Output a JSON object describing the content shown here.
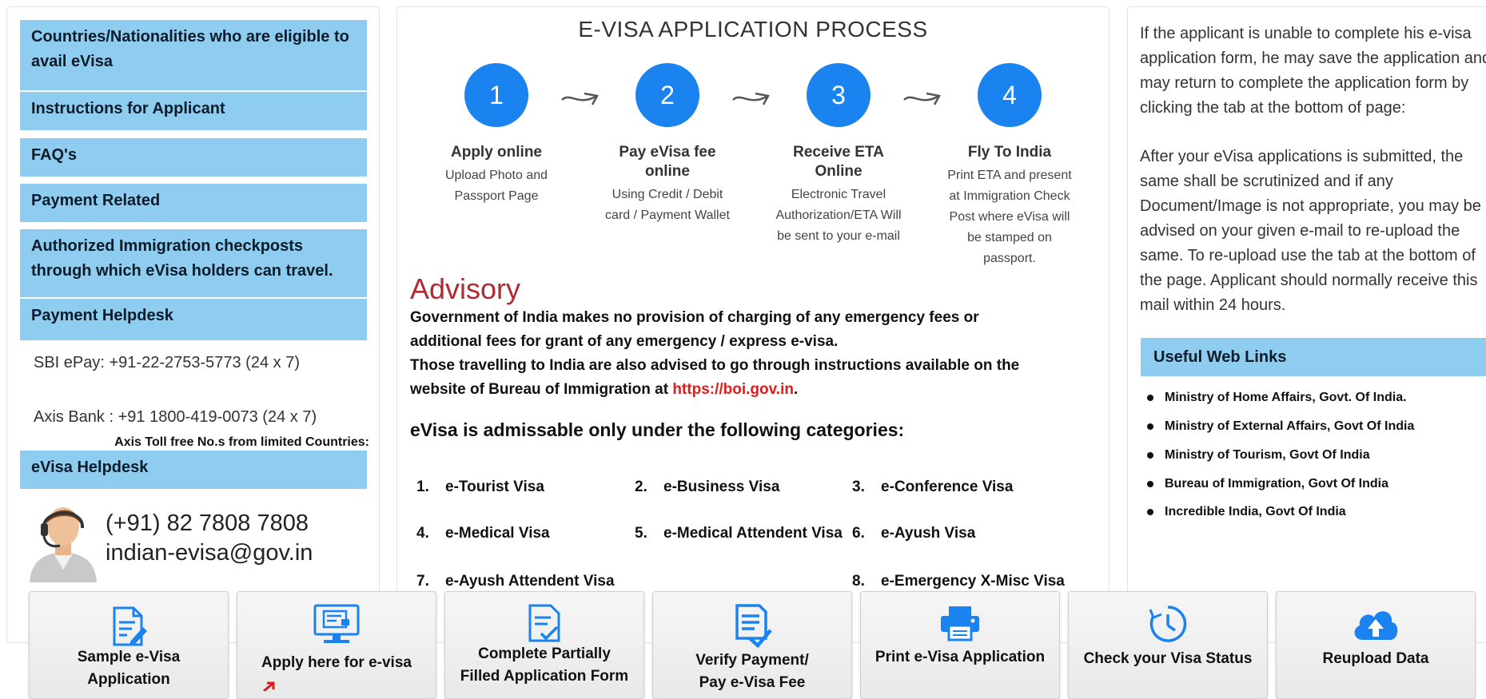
{
  "sidebar": {
    "items": [
      {
        "label": "Countries/Nationalities who are eligible to avail eVisa"
      },
      {
        "label": "Instructions for Applicant"
      },
      {
        "label": "FAQ's"
      },
      {
        "label": "Payment Related"
      },
      {
        "label": "Authorized Immigration checkposts through which eVisa holders can travel."
      },
      {
        "label": "Payment Helpdesk"
      }
    ],
    "payment_helpdesk": {
      "sbi": "SBI ePay: +91-22-2753-5773 (24 x 7)",
      "axis": "Axis Bank : +91 1800-419-0073 (24 x 7)",
      "toll_free_note": "Axis Toll free No.s from limited Countries:"
    },
    "evisa_helpdesk": {
      "label": "eVisa Helpdesk",
      "phone": "(+91) 82 7808 7808",
      "email": "indian-evisa@gov.in"
    }
  },
  "process": {
    "title": "E-VISA APPLICATION PROCESS",
    "steps": [
      {
        "number": "1",
        "title": "Apply online",
        "desc": "Upload Photo and Passport Page"
      },
      {
        "number": "2",
        "title": "Pay eVisa fee online",
        "desc": "Using Credit / Debit card / Payment Wallet"
      },
      {
        "number": "3",
        "title": "Receive ETA Online",
        "desc": "Electronic Travel Authorization/ETA Will be sent to your e-mail"
      },
      {
        "number": "4",
        "title": "Fly To India",
        "desc": "Print ETA and present at Immigration Check Post where eVisa will be stamped on passport."
      }
    ]
  },
  "advisory": {
    "heading": "Advisory",
    "line1": "Government of India makes no provision of charging of any emergency fees or",
    "line2": "additional fees for grant of any emergency / express e-visa.",
    "line3": "Those travelling to India are also advised to go through instructions available on the",
    "line4_prefix": "website of Bureau of Immigration at ",
    "link": "https://boi.gov.in",
    "line4_suffix": ".",
    "categories_heading": "eVisa is admissable only under the following categories:",
    "categories": [
      {
        "num": "1.",
        "label": "e-Tourist Visa"
      },
      {
        "num": "2.",
        "label": "e-Business Visa"
      },
      {
        "num": "3.",
        "label": "e-Conference Visa"
      },
      {
        "num": "4.",
        "label": "e-Medical Visa"
      },
      {
        "num": "5.",
        "label": "e-Medical Attendent Visa"
      },
      {
        "num": "6.",
        "label": "e-Ayush Visa"
      },
      {
        "num": "7.",
        "label": "e-Ayush Attendent Visa"
      },
      {
        "num": "8.",
        "label": "e-Emergency X-Misc Visa"
      }
    ]
  },
  "info": {
    "para1": "If the applicant is unable to complete his e-visa application form, he may save the application and may return to complete the application form by clicking the tab at the bottom of page:",
    "para2": "After your eVisa applications is submitted, the same shall be scrutinized and if any Document/Image is not appropriate, you may be advised on your given e-mail to re-upload the same. To re-upload use the tab at the bottom of the page. Applicant should normally receive this mail within 24 hours."
  },
  "web_links": {
    "header": "Useful Web Links",
    "items": [
      "Ministry of Home Affairs, Govt. Of India.",
      "Ministry of External Affairs, Govt Of India",
      "Ministry of Tourism, Govt Of India",
      "Bureau of Immigration, Govt Of India",
      "Incredible India, Govt Of India"
    ]
  },
  "tiles": [
    {
      "label1": "Sample e-Visa",
      "label2": "Application",
      "icon": "document-edit-icon"
    },
    {
      "label1": "Apply here for e-visa",
      "label2": "",
      "icon": "monitor-form-icon"
    },
    {
      "label1": "Complete Partially",
      "label2": "Filled Application Form",
      "icon": "checklist-icon"
    },
    {
      "label1": "Verify Payment/",
      "label2": "Pay e-Visa Fee",
      "icon": "document-check-icon"
    },
    {
      "label1": "Print e-Visa Application",
      "label2": "",
      "icon": "printer-icon"
    },
    {
      "label1": "Check your Visa Status",
      "label2": "",
      "icon": "clock-refresh-icon"
    },
    {
      "label1": "Reupload Data",
      "label2": "",
      "icon": "cloud-upload-icon"
    }
  ],
  "colors": {
    "sidebar_bg": "#8ecdef",
    "step_circle": "#1a83f0",
    "advisory_red": "#b02a30",
    "link_red": "#e01b1b",
    "icon_blue": "#1a83f0"
  }
}
